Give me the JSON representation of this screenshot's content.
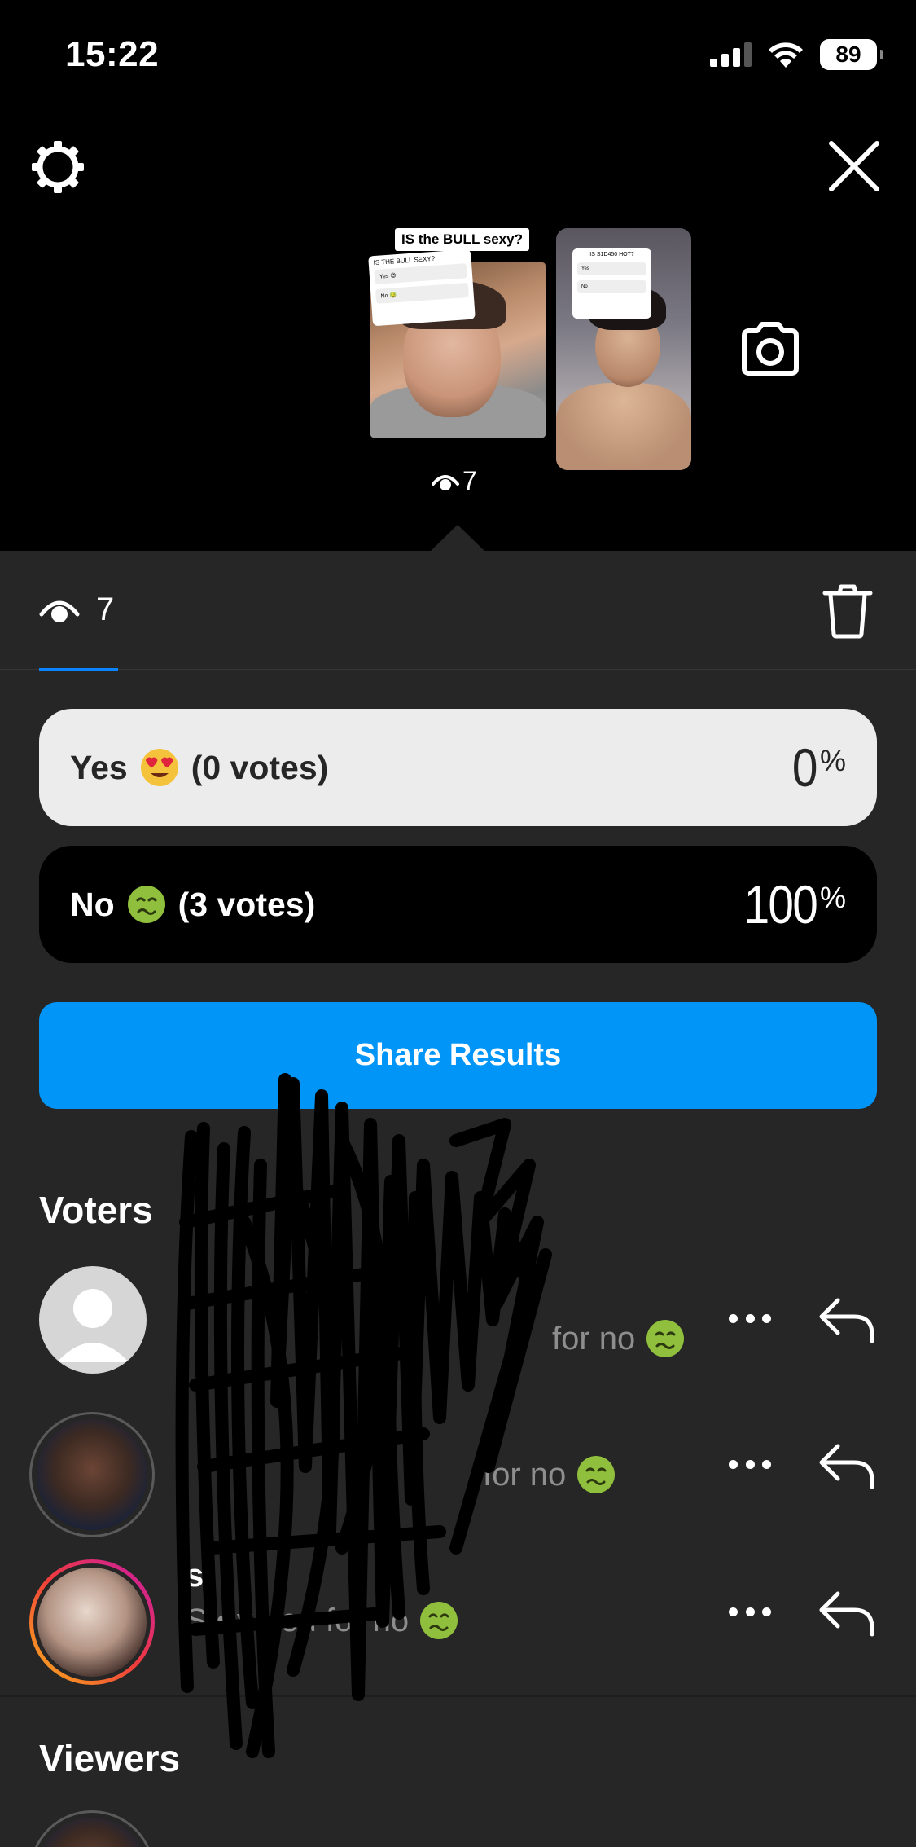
{
  "status_bar": {
    "time": "15:22",
    "battery": "89"
  },
  "story": {
    "thumb1_question": "IS the BULL sexy?",
    "thumb1_poll_question": "IS THE BULL SEXY?",
    "thumb1_poll_options": [
      "Yes 😍",
      "No 🤢"
    ],
    "thumb2_poll_question": "IS S1D450 HOT?",
    "thumb2_poll_options": [
      "Yes",
      "No"
    ],
    "views": "7"
  },
  "sheet": {
    "views_count": "7",
    "poll": {
      "options": [
        {
          "label": "Yes",
          "emoji": "😍",
          "votes_text": "(0 votes)",
          "percent": "0",
          "percent_value": 0
        },
        {
          "label": "No",
          "emoji": "🤢",
          "votes_text": "(3 votes)",
          "percent": "100",
          "percent_value": 100
        }
      ],
      "percent_symbol": "%"
    },
    "share_label": "Share Results",
    "voters_title": "Voters",
    "voters": [
      {
        "line2": "for no",
        "emoji": "🤢"
      },
      {
        "line2": "for no",
        "emoji": "🤢"
      },
      {
        "line1": "s",
        "line2": "S • voted for no",
        "emoji": "🤢"
      }
    ],
    "viewers_title": "Viewers"
  },
  "colors": {
    "background": "#000000",
    "sheet": "#262626",
    "accent_blue": "#0095f6",
    "muted_text": "#8e8e8e",
    "yes_bar": "#ececec",
    "no_bar": "#000000"
  },
  "icons": [
    "settings-gear-icon",
    "close-icon",
    "camera-icon",
    "eye-icon",
    "trash-icon",
    "more-icon",
    "reply-icon"
  ]
}
